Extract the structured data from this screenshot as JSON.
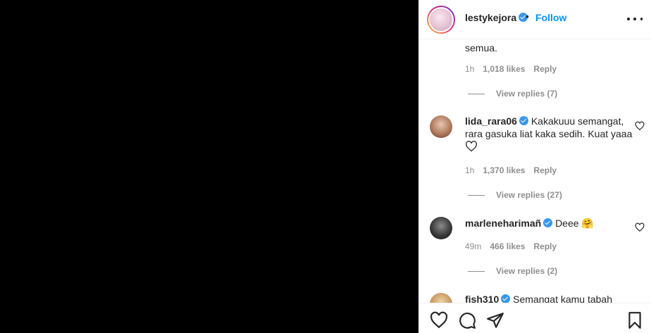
{
  "post": {
    "username": "lestykejora",
    "separator": "•",
    "follow_label": "Follow"
  },
  "comments": [
    {
      "text_tail": "semua.",
      "time": "1h",
      "likes": "1,018 likes",
      "reply_label": "Reply",
      "view_replies": "View replies (7)"
    },
    {
      "username": "lida_rara06",
      "text": "Kakakuuu semangat, rara gasuka liat kaka sedih. Kuat yaaa",
      "time": "1h",
      "likes": "1,370 likes",
      "reply_label": "Reply",
      "view_replies": "View replies (27)"
    },
    {
      "username": "marleneharimañ",
      "text": "Deee",
      "emoji": "🤗",
      "time": "49m",
      "likes": "466 likes",
      "reply_label": "Reply",
      "view_replies": "View replies (2)"
    },
    {
      "username": "fish310",
      "text": "Semangat kamu tabah"
    }
  ],
  "colors": {
    "verified": "#3897f0",
    "follow": "#0095f6",
    "muted": "#8e8e8e"
  }
}
